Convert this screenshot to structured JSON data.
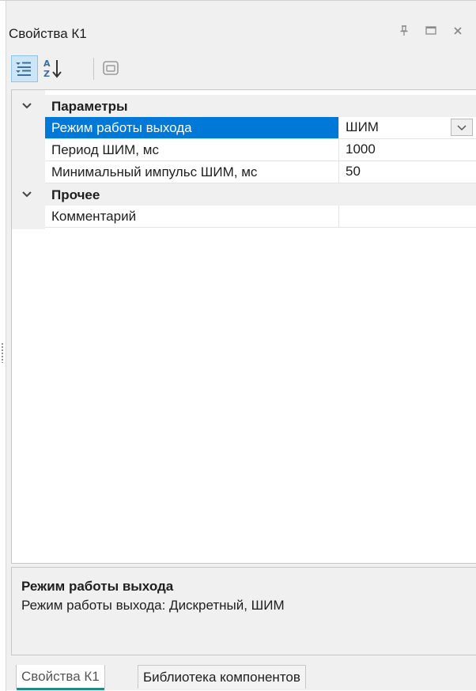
{
  "window": {
    "title": "Свойства К1",
    "pin_icon": "pin-icon",
    "maximize_icon": "maximize-icon",
    "close_icon": "close-icon"
  },
  "toolbar": {
    "categorized_icon": "categorized-view-icon",
    "alphabetical_icon": "sort-az-icon",
    "property_pages_icon": "property-pages-icon"
  },
  "grid": {
    "categories": [
      {
        "label": "Параметры",
        "properties": [
          {
            "name": "Режим работы выхода",
            "value": "ШИМ",
            "selected": true,
            "has_dropdown": true
          },
          {
            "name": "Период ШИМ, мс",
            "value": "1000"
          },
          {
            "name": "Минимальный импульс ШИМ, мс",
            "value": "50"
          }
        ]
      },
      {
        "label": "Прочее",
        "properties": [
          {
            "name": "Комментарий",
            "value": ""
          }
        ]
      }
    ]
  },
  "description": {
    "title": "Режим работы выхода",
    "text": "Режим работы выхода: Дискретный, ШИМ"
  },
  "tabs": [
    {
      "label": "Свойства К1",
      "active": true
    },
    {
      "label": "Библиотека компонентов",
      "active": false
    }
  ],
  "colors": {
    "selection": "#0078d7",
    "panel_bg": "#f0f0f0",
    "active_tab_underline": "#1e8a8a"
  }
}
